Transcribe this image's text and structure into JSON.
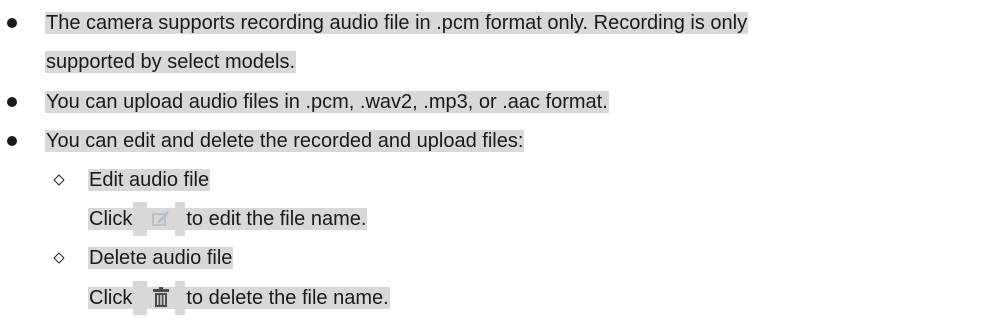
{
  "notes": {
    "items": [
      {
        "lines": [
          "The camera supports recording audio file in .pcm format only. Recording is only",
          "supported by select models."
        ]
      },
      {
        "lines": [
          "You can upload audio files in .pcm, .wav2, .mp3, or .aac format."
        ]
      },
      {
        "lines": [
          "You can edit and delete the recorded and upload files:"
        ],
        "subitems": [
          {
            "title": "Edit audio file",
            "click_prefix": "Click",
            "click_suffix": "to edit the file name.",
            "icon": "edit-icon"
          },
          {
            "title": "Delete audio file",
            "click_prefix": "Click",
            "click_suffix": "to delete the file name.",
            "icon": "trash-icon"
          }
        ]
      }
    ]
  },
  "colors": {
    "highlight": "#d8d8d8",
    "text": "#1a1a1a",
    "edit_icon": "#b5bfc6",
    "trash_icon": "#4a4a4a"
  }
}
